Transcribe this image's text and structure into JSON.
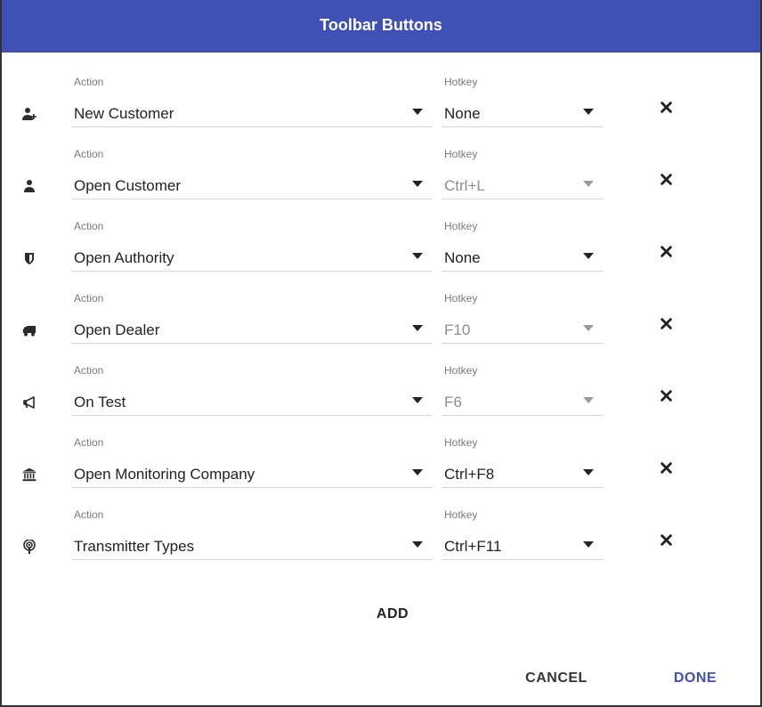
{
  "dialog": {
    "title": "Toolbar Buttons",
    "add_label": "ADD",
    "cancel_label": "CANCEL",
    "done_label": "DONE",
    "accent_color": "#3f51b5"
  },
  "rows": [
    {
      "icon": "user-plus-icon",
      "action_label": "Action",
      "action_value": "New Customer",
      "hotkey_label": "Hotkey",
      "hotkey_value": "None",
      "hotkey_disabled": false
    },
    {
      "icon": "user-icon",
      "action_label": "Action",
      "action_value": "Open Customer",
      "hotkey_label": "Hotkey",
      "hotkey_value": "Ctrl+L",
      "hotkey_disabled": true
    },
    {
      "icon": "shield-icon",
      "action_label": "Action",
      "action_value": "Open Authority",
      "hotkey_label": "Hotkey",
      "hotkey_value": "None",
      "hotkey_disabled": false
    },
    {
      "icon": "truck-icon",
      "action_label": "Action",
      "action_value": "Open Dealer",
      "hotkey_label": "Hotkey",
      "hotkey_value": "F10",
      "hotkey_disabled": true
    },
    {
      "icon": "megaphone-icon",
      "action_label": "Action",
      "action_value": "On Test",
      "hotkey_label": "Hotkey",
      "hotkey_value": "F6",
      "hotkey_disabled": true
    },
    {
      "icon": "bank-icon",
      "action_label": "Action",
      "action_value": "Open Monitoring Company",
      "hotkey_label": "Hotkey",
      "hotkey_value": "Ctrl+F8",
      "hotkey_disabled": false
    },
    {
      "icon": "transmitter-icon",
      "action_label": "Action",
      "action_value": "Transmitter Types",
      "hotkey_label": "Hotkey",
      "hotkey_value": "Ctrl+F11",
      "hotkey_disabled": false
    }
  ]
}
